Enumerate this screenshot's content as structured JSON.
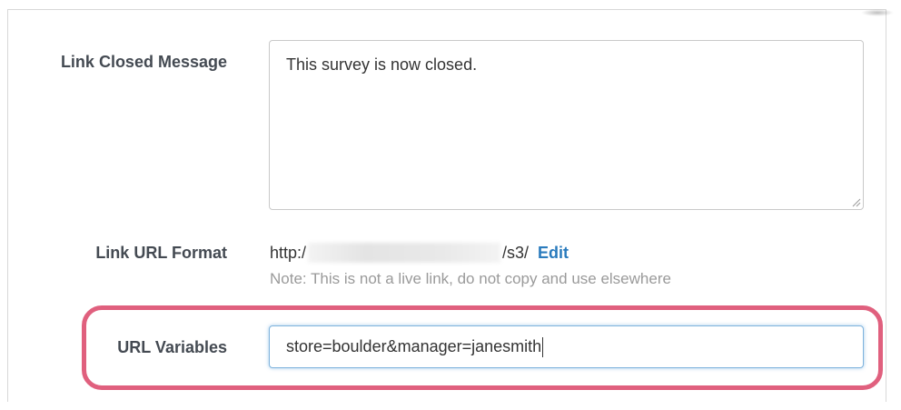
{
  "link_closed_message": {
    "label": "Link Closed Message",
    "value": "This survey is now closed."
  },
  "link_url_format": {
    "label": "Link URL Format",
    "url_prefix": "http:/",
    "url_suffix": "/s3/",
    "edit_label": "Edit",
    "note": "Note: This is not a live link, do not copy and use elsewhere"
  },
  "url_variables": {
    "label": "URL Variables",
    "value": "store=boulder&manager=janesmith"
  },
  "colors": {
    "highlight": "#e0607e",
    "link": "#2a7bbd",
    "label": "#444a52"
  }
}
